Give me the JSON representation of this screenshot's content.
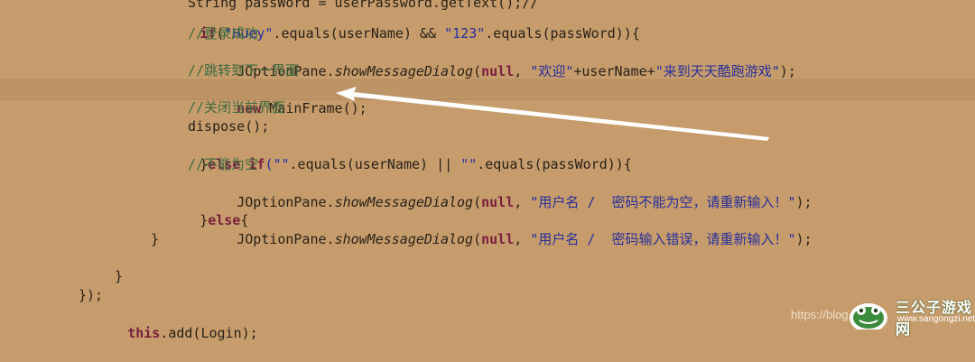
{
  "code": {
    "line0": "String passWord = userPassword.getText();//",
    "line1_if": "if",
    "line1_s1": "\"Huey\"",
    "line1_mid": ".equals(userName) && ",
    "line1_s2": "\"123\"",
    "line1_end": ".equals(passWord)){",
    "line2_cmt": "//登录成功",
    "line3_pre": "JOptionPane.",
    "line3_m": "showMessageDialog",
    "line3_paren": "(",
    "line3_null": "null",
    "line3_comma": ", ",
    "line3_s1": "\"欢迎\"",
    "line3_mid": "+userName+",
    "line3_s2": "\"来到天天酷跑游戏\"",
    "line3_end": ");",
    "line4_cmt": "//跳转到下一界面",
    "line5_new": "new",
    "line5_rest": " MainFrame();",
    "line6_cmt": "//关闭当前界面",
    "line7": "dispose();",
    "line8_brace": "}",
    "line8_else": "else",
    "line8_sp": " ",
    "line8_if": "if",
    "line8_s1": "(\"\"",
    "line8_mid": ".equals(userName) || ",
    "line8_s2": "\"\"",
    "line8_end": ".equals(passWord)){",
    "line9_cmt": "//不能为空",
    "line10_pre": "JOptionPane.",
    "line10_m": "showMessageDialog",
    "line10_paren": "(",
    "line10_null": "null",
    "line10_comma": ", ",
    "line10_s": "\"用户名 /  密码不能为空，请重新输入！\"",
    "line10_end": ");",
    "line11_brace": "}",
    "line11_else": "else",
    "line11_open": "{",
    "line12_pre": "JOptionPane.",
    "line12_m": "showMessageDialog",
    "line12_paren": "(",
    "line12_null": "null",
    "line12_comma": ", ",
    "line12_s": "\"用户名 /  密码输入错误，请重新输入！\"",
    "line12_end": ");",
    "line13": "}",
    "line15": "}",
    "line16": "});",
    "line17_this": "this",
    "line17_rest": ".add(Login);"
  },
  "watermark": {
    "url": "https://blog",
    "title": "三公子游戏网",
    "site": "www.sangongzi.net",
    "colors": {
      "logo_green": "#3c8a3c",
      "logo_white": "#ffffff"
    }
  },
  "annotation": {
    "arrow_color": "#ffffff"
  }
}
